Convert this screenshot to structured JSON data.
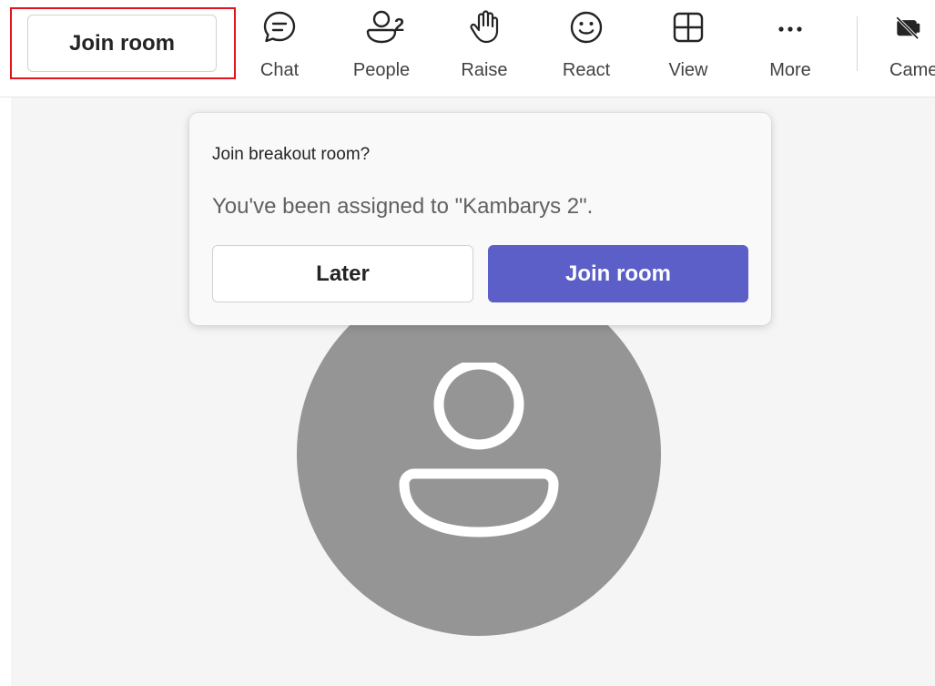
{
  "toolbar": {
    "join_room_label": "Join room",
    "items": [
      {
        "label": "Chat",
        "icon": "chat-icon"
      },
      {
        "label": "People",
        "icon": "people-icon",
        "count": "2"
      },
      {
        "label": "Raise",
        "icon": "raise-hand-icon"
      },
      {
        "label": "React",
        "icon": "react-smiley-icon"
      },
      {
        "label": "View",
        "icon": "view-grid-icon"
      },
      {
        "label": "More",
        "icon": "more-icon"
      },
      {
        "label": "Came",
        "icon": "camera-off-icon"
      }
    ]
  },
  "popup": {
    "title": "Join breakout room?",
    "message": "You've been assigned to \"Kambarys 2\".",
    "later_label": "Later",
    "join_label": "Join room"
  },
  "stage": {
    "avatar_icon": "person-icon"
  },
  "colors": {
    "primary": "#5b5fc7",
    "highlight": "#e0141e",
    "avatar": "#959595",
    "stage_bg": "#f5f5f5"
  }
}
